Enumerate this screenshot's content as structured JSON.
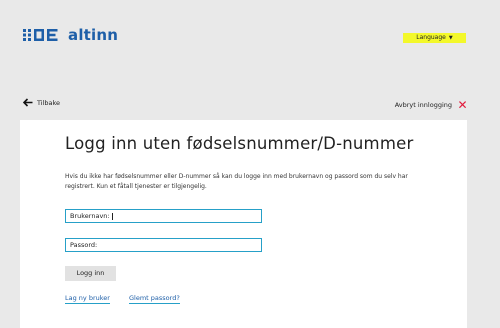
{
  "header": {
    "logo_text": "altinn",
    "language_label": "Language"
  },
  "nav": {
    "back_label": "Tilbake",
    "cancel_label": "Avbryt innlogging"
  },
  "colors": {
    "brand_blue": "#1e5fa8",
    "language_highlight": "#f3f82a",
    "cancel_red": "#e11a3b",
    "field_border": "#26a0c8"
  },
  "form": {
    "title": "Logg inn uten fødselsnummer/D-nummer",
    "description": "Hvis du ikke har fødselsnummer eller D-nummer så kan du logge inn med brukernavn og passord som du selv har registrert. Kun et fåtall tjenester er tilgjengelig.",
    "username_label": "Brukernavn:",
    "password_label": "Passord:",
    "submit_label": "Logg inn",
    "register_link": "Lag ny bruker",
    "forgot_link": "Glemt passord?"
  }
}
